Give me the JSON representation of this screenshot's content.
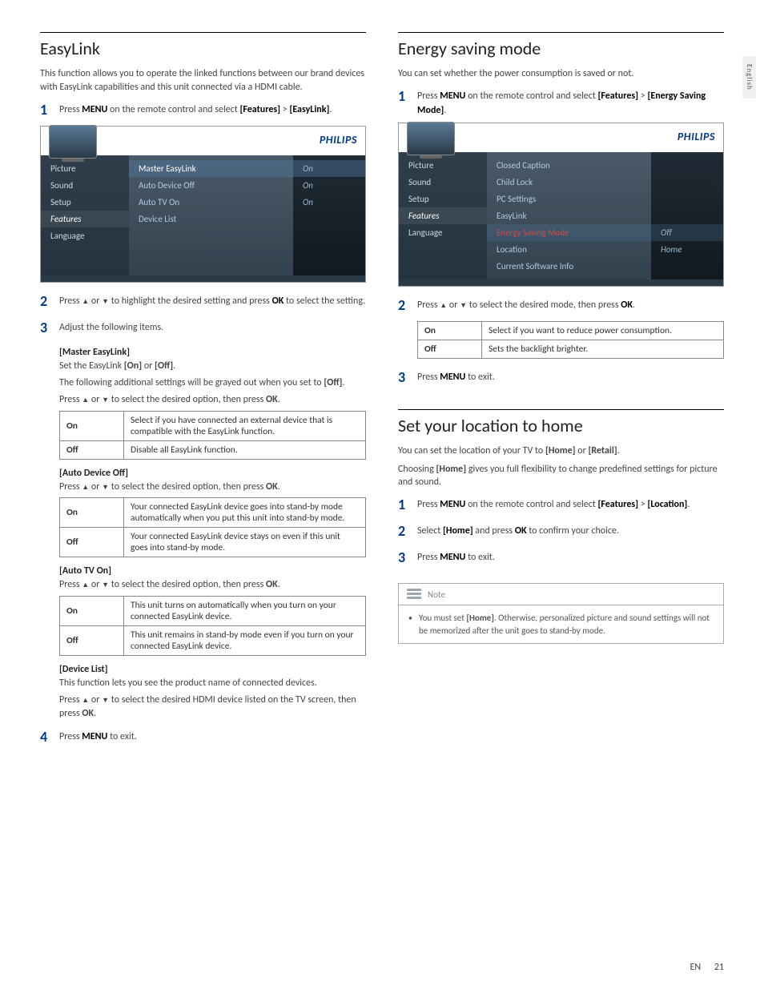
{
  "langtab": "English",
  "footer": {
    "lang": "EN",
    "page": "21"
  },
  "left": {
    "heading": "EasyLink",
    "intro": "This function allows you to operate the linked functions between our brand devices with EasyLink capabilities and this unit connected via a HDMI cable.",
    "step1": {
      "pre": "Press ",
      "b1": "MENU",
      "mid": " on the remote control and select ",
      "b2": "[Features]",
      "post": " > ",
      "b3": "[EasyLink]",
      "end": "."
    },
    "brand": "PHILIPS",
    "tv_side": [
      "Picture",
      "Sound",
      "Setup",
      "Features",
      "Language"
    ],
    "tv_side_active": "Features",
    "tv_main": [
      {
        "label": "Master EasyLink",
        "value": "On",
        "hl": true
      },
      {
        "label": "Auto Device Off",
        "value": "On"
      },
      {
        "label": "Auto TV On",
        "value": "On"
      },
      {
        "label": "Device List",
        "value": ""
      }
    ],
    "step2": {
      "pre": "Press ",
      "mid": " or ",
      "post": " to highlight the desired setting and press ",
      "b1": "OK",
      "end": " to select the setting."
    },
    "step3": "Adjust the following items.",
    "sub_master_head": "[Master EasyLink]",
    "sub_master_line1": {
      "pre": "Set the EasyLink ",
      "b1": "[On]",
      "mid": " or ",
      "b2": "[Off]",
      "end": "."
    },
    "sub_master_line2": {
      "pre": "The following additional settings will be grayed out when you set to ",
      "b1": "[Off]",
      "end": "."
    },
    "press_select": {
      "pre": "Press ",
      "mid": " or ",
      "post": " to select the desired option, then press ",
      "b1": "OK",
      "end": "."
    },
    "tbl_master": {
      "on": "Select if you have connected an external device that is compatible with the EasyLink function.",
      "off": "Disable all EasyLink function."
    },
    "sub_auto_off_head": "[Auto Device Off]",
    "tbl_auto_off": {
      "on": "Your connected EasyLink device goes into stand-by mode automatically when you put this unit into stand-by mode.",
      "off": "Your connected EasyLink device stays on even if this unit goes into stand-by mode."
    },
    "sub_autotv_head": "[Auto TV On]",
    "tbl_autotv": {
      "on": "This unit turns on automatically when you turn on your connected EasyLink device.",
      "off": "This unit remains in stand-by mode even if you turn on your connected EasyLink device."
    },
    "sub_devlist_head": "[Device List]",
    "sub_devlist_line": "This function lets you see the product name of connected devices.",
    "sub_devlist_press": {
      "pre": "Press ",
      "mid": " or ",
      "post": " to select the desired HDMI device listed on the TV screen, then press ",
      "b1": "OK",
      "end": "."
    },
    "step4": {
      "pre": "Press ",
      "b1": "MENU",
      "end": " to exit."
    }
  },
  "right": {
    "heading1": "Energy saving mode",
    "intro1": "You can set whether the power consumption is saved or not.",
    "step1": {
      "pre": "Press ",
      "b1": "MENU",
      "mid": " on the remote control and select ",
      "b2": "[Features]",
      "post": " > ",
      "b3": "[Energy Saving Mode]",
      "end": "."
    },
    "brand": "PHILIPS",
    "tv_side": [
      "Picture",
      "Sound",
      "Setup",
      "Features",
      "Language"
    ],
    "tv_side_active": "Features",
    "tv_main": [
      {
        "label": "Closed Caption",
        "value": ""
      },
      {
        "label": "Child Lock",
        "value": ""
      },
      {
        "label": "PC Settings",
        "value": ""
      },
      {
        "label": "EasyLink",
        "value": ""
      },
      {
        "label": "Energy Saving Mode",
        "value": "Off",
        "red": true
      },
      {
        "label": "Location",
        "value": "Home"
      },
      {
        "label": "Current Software Info",
        "value": ""
      }
    ],
    "step2": {
      "pre": "Press ",
      "mid": " or ",
      "post": " to select the desired mode, then press ",
      "b1": "OK",
      "end": "."
    },
    "tbl_energy": {
      "on": "Select if you want to reduce power consumption.",
      "off": "Sets the backlight brighter."
    },
    "step3": {
      "pre": "Press ",
      "b1": "MENU",
      "end": " to exit."
    },
    "heading2": "Set your location to home",
    "loc_line1": {
      "pre": "You can set the location of your TV to ",
      "b1": "[Home]",
      "mid": " or ",
      "b2": "[Retail]",
      "end": "."
    },
    "loc_line2": {
      "pre": "Choosing ",
      "b1": "[Home]",
      "end": " gives you full flexibility to change predefined settings for picture and sound."
    },
    "loc_step1": {
      "pre": "Press ",
      "b1": "MENU",
      "mid": " on the remote control and select ",
      "b2": "[Features]",
      "post": " > ",
      "b3": "[Location]",
      "end": "."
    },
    "loc_step2": {
      "pre": "Select ",
      "b1": "[Home]",
      "mid": " and press ",
      "b2": "OK",
      "end": " to confirm your choice."
    },
    "loc_step3": {
      "pre": "Press ",
      "b1": "MENU",
      "end": " to exit."
    },
    "note_title": "Note",
    "note_body": {
      "pre": "You must set ",
      "b1": "[Home]",
      "end": ". Otherwise, personalized picture and sound settings will not be memorized after the unit goes to stand-by mode."
    }
  },
  "labels": {
    "on": "On",
    "off": "Off"
  }
}
